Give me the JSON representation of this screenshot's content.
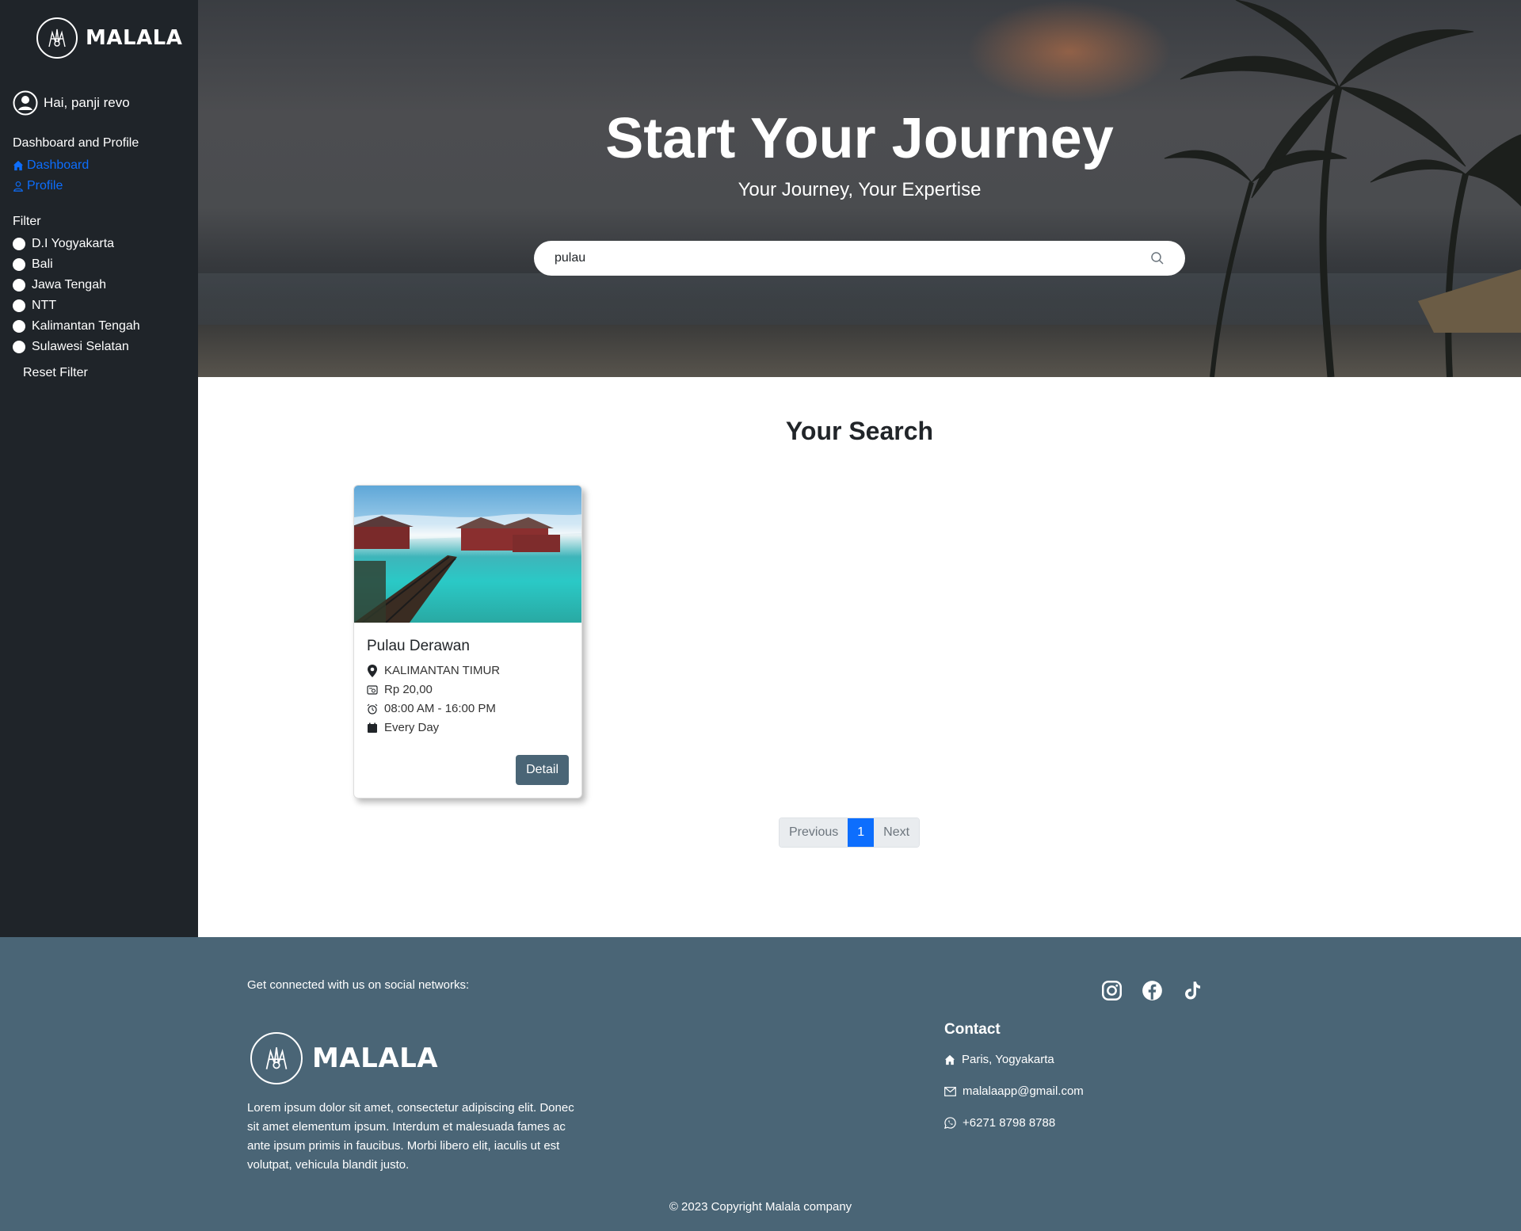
{
  "brand": {
    "name": "MALALA"
  },
  "sidebar": {
    "greeting": "Hai, panji revo",
    "dashboard_heading": "Dashboard and Profile",
    "links": [
      {
        "label": "Dashboard",
        "icon": "home-icon"
      },
      {
        "label": "Profile",
        "icon": "user-icon"
      }
    ],
    "filter_heading": "Filter",
    "filters": [
      "D.I Yogyakarta",
      "Bali",
      "Jawa Tengah",
      "NTT",
      "Kalimantan Tengah",
      "Sulawesi Selatan"
    ],
    "reset_label": "Reset Filter"
  },
  "hero": {
    "title": "Start Your Journey",
    "subtitle": "Your Journey, Your Expertise",
    "search_value": "pulau"
  },
  "results": {
    "title": "Your Search",
    "cards": [
      {
        "name": "Pulau Derawan",
        "location": "KALIMANTAN TIMUR",
        "price": "Rp 20,00",
        "hours": "08:00 AM - 16:00 PM",
        "days": "Every Day",
        "button": "Detail"
      }
    ]
  },
  "pagination": {
    "previous": "Previous",
    "current": "1",
    "next": "Next"
  },
  "footer": {
    "connect_text": "Get connected with us on social networks:",
    "social": [
      "instagram-icon",
      "facebook-icon",
      "tiktok-icon"
    ],
    "about": "Lorem ipsum dolor sit amet, consectetur adipiscing elit. Donec sit amet elementum ipsum. Interdum et malesuada fames ac ante ipsum primis in faucibus. Morbi libero elit, iaculis ut est volutpat, vehicula blandit justo.",
    "contact_title": "Contact",
    "contact": {
      "address": "Paris, Yogyakarta",
      "email": "malalaapp@gmail.com",
      "phone": "+6271 8798 8788"
    },
    "copyright": "© 2023 Copyright Malala company"
  },
  "colors": {
    "sidebar_bg": "#1f2429",
    "link": "#0d6efd",
    "footer_bg": "#4a6576",
    "button_bg": "#4a6576"
  }
}
